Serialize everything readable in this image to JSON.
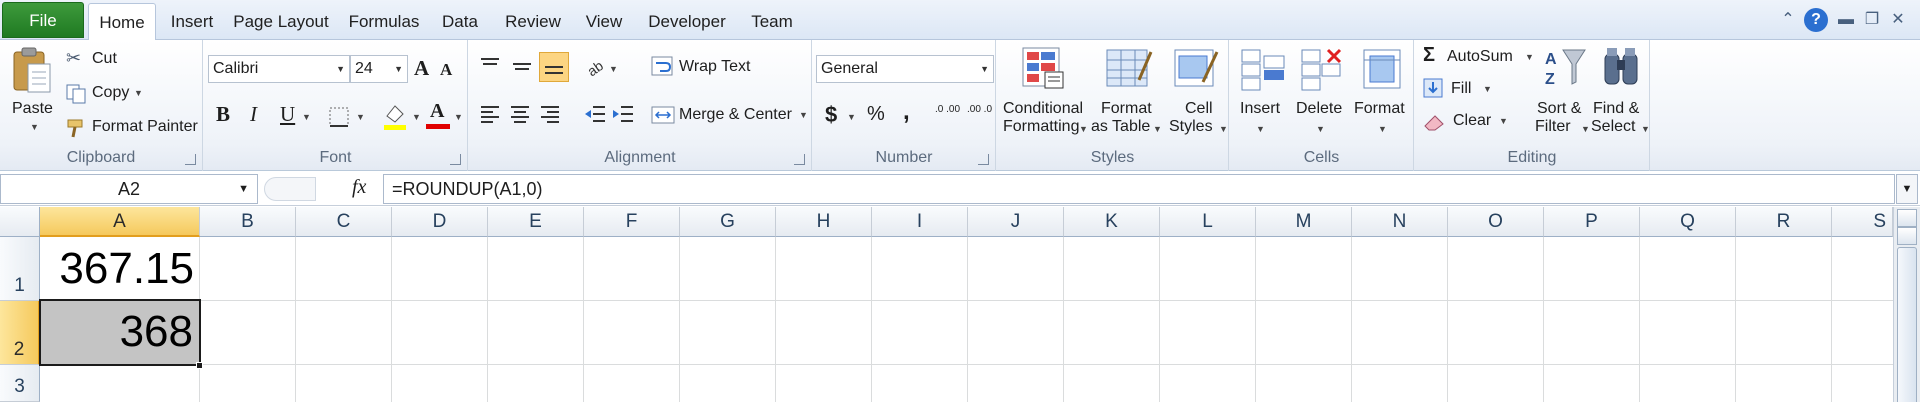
{
  "tabs": [
    "File",
    "Home",
    "Insert",
    "Page Layout",
    "Formulas",
    "Data",
    "Review",
    "View",
    "Developer",
    "Team"
  ],
  "active_tab": "Home",
  "clipboard": {
    "paste": "Paste",
    "cut": "Cut",
    "copy": "Copy",
    "format_painter": "Format Painter",
    "label": "Clipboard"
  },
  "font": {
    "name": "Calibri",
    "size": "24",
    "bold": "B",
    "italic": "I",
    "underline": "U",
    "label": "Font",
    "grow": "A",
    "shrink": "A",
    "font_color_glyph": "A"
  },
  "alignment": {
    "wrap_text": "Wrap Text",
    "merge_center": "Merge & Center",
    "label": "Alignment"
  },
  "number": {
    "format": "General",
    "currency": "$",
    "percent": "%",
    "comma": ",",
    "inc_decimal": ".0 .00",
    "dec_decimal": ".00 .0",
    "label": "Number"
  },
  "styles": {
    "conditional_1": "Conditional",
    "conditional_2": "Formatting",
    "format_table_1": "Format",
    "format_table_2": "as Table",
    "cell_styles_1": "Cell",
    "cell_styles_2": "Styles",
    "label": "Styles"
  },
  "cells": {
    "insert": "Insert",
    "delete": "Delete",
    "format": "Format",
    "label": "Cells"
  },
  "editing": {
    "autosum": "AutoSum",
    "fill": "Fill",
    "clear": "Clear",
    "sort_1": "Sort &",
    "sort_2": "Filter",
    "find_1": "Find &",
    "find_2": "Select",
    "label": "Editing",
    "sigma": "Σ"
  },
  "formula_bar": {
    "name_box": "A2",
    "fx": "fx",
    "formula": "=ROUNDUP(A1,0)"
  },
  "columns": [
    "A",
    "B",
    "C",
    "D",
    "E",
    "F",
    "G",
    "H",
    "I",
    "J",
    "K",
    "L",
    "M",
    "N",
    "O",
    "P",
    "Q",
    "R",
    "S"
  ],
  "rows": [
    "1",
    "2",
    "3"
  ],
  "cell_values": {
    "A1": "367.15",
    "A2": "368"
  },
  "colors": {
    "file_tab": "#2a8a2c",
    "selection_header": "#f5c95d",
    "selected_cell_fill": "#c4c4c4",
    "accent": "#2b6fd0"
  }
}
